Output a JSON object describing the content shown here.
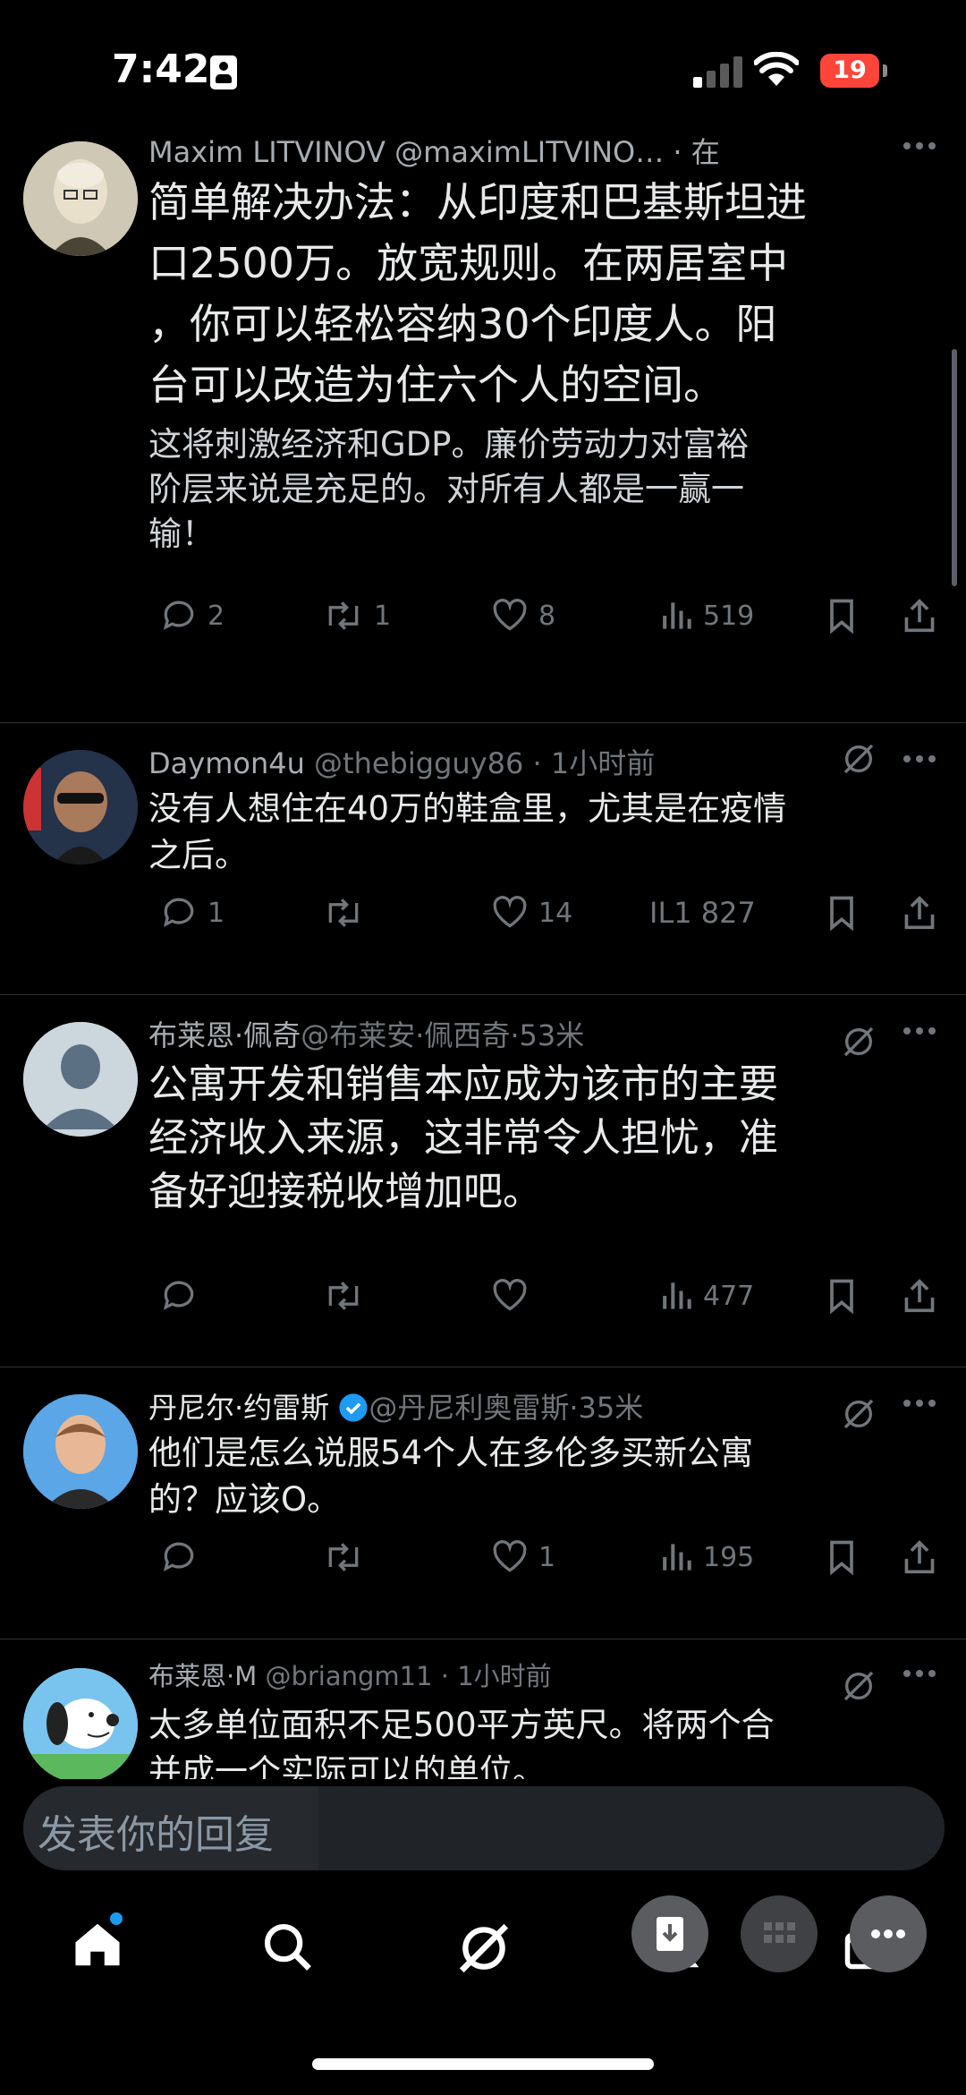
{
  "status_bar": {
    "time": "7:42",
    "battery": "19"
  },
  "colors": {
    "accent": "#1d9bf0",
    "battery": "#ff453a",
    "background": "#000000"
  },
  "posts": [
    {
      "header": "Maxim LITVINOV @maximLITVINO… · 在",
      "lines_large": [
        "简单解决办法：从印度和巴基斯坦进",
        "口2500万。放宽规则。在两居室中",
        "，你可以轻松容纳30个印度人。阳",
        "台可以改造为住六个人的空间。"
      ],
      "lines_small": [
        "这将刺激经济和GDP。廉价劳动力对富裕",
        "阶层来说是充足的。对所有人都是一赢一",
        "输！"
      ],
      "replies": "2",
      "reposts": "1",
      "likes": "8",
      "views": "519"
    },
    {
      "name": "Daymon4u",
      "meta": "@thebigguy86 · 1小时前",
      "lines": [
        "没有人想住在40万的鞋盒里，尤其是在疫情",
        "之后。"
      ],
      "replies": "1",
      "reposts": "",
      "likes": "14",
      "views": "IL1 827"
    },
    {
      "name": "布莱恩·佩奇",
      "meta": "@布莱安·佩西奇·53米",
      "lines": [
        "公寓开发和销售本应成为该市的主要",
        "经济收入来源，这非常令人担忧，准",
        "备好迎接税收增加吧。"
      ],
      "replies": "",
      "reposts": "",
      "likes": "",
      "views": "477"
    },
    {
      "name": "丹尼尔·约雷斯",
      "meta": "@丹尼利奥雷斯·35米",
      "lines": [
        "他们是怎么说服54个人在多伦多买新公寓",
        "的？应该O。"
      ],
      "replies": "",
      "reposts": "",
      "likes": "1",
      "views": "195"
    },
    {
      "name": "布莱恩·M",
      "meta": "@briangm11 · 1小时前",
      "lines": [
        "太多单位面积不足500平方英尺。将两个合",
        "并成一个实际可以的单位。"
      ]
    }
  ],
  "reply_placeholder": "发表你的回复",
  "nav": [
    "home-icon",
    "search-icon",
    "grok-icon",
    "notifications-icon",
    "messages-icon"
  ]
}
